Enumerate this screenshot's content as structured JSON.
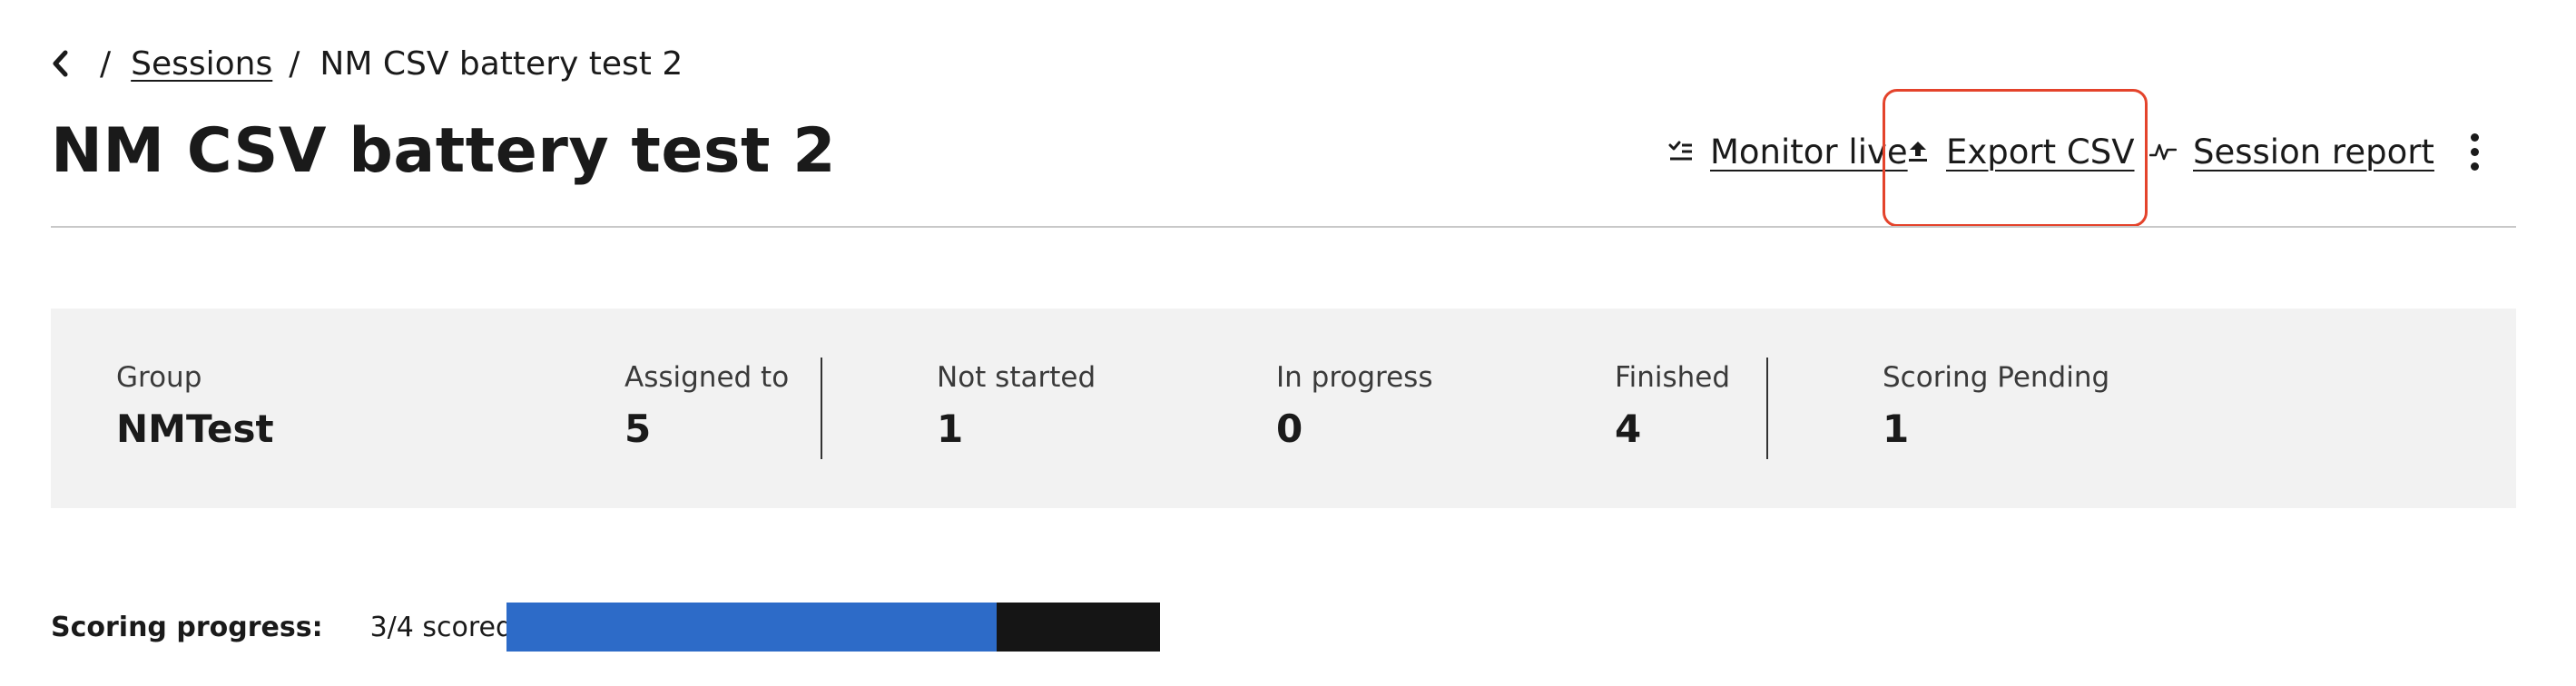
{
  "breadcrumb": {
    "separator": "/",
    "parent": "Sessions",
    "current": "NM CSV battery test 2"
  },
  "page": {
    "title": "NM CSV battery test 2"
  },
  "actions": {
    "monitor_live": "Monitor live",
    "export_csv": "Export CSV",
    "session_report": "Session report"
  },
  "stats": {
    "group": {
      "label": "Group",
      "value": "NMTest"
    },
    "assigned": {
      "label": "Assigned to",
      "value": "5"
    },
    "not_started": {
      "label": "Not started",
      "value": "1"
    },
    "in_progress": {
      "label": "In progress",
      "value": "0"
    },
    "finished": {
      "label": "Finished",
      "value": "4"
    },
    "scoring_pending": {
      "label": "Scoring Pending",
      "value": "1"
    }
  },
  "scoring": {
    "label": "Scoring progress:",
    "text": "3/4 scored",
    "scored": 3,
    "total": 4
  },
  "colors": {
    "accent": "#2d6bc8",
    "highlight": "#e4432b",
    "panel": "#f2f2f2",
    "bar_remaining": "#151515"
  }
}
